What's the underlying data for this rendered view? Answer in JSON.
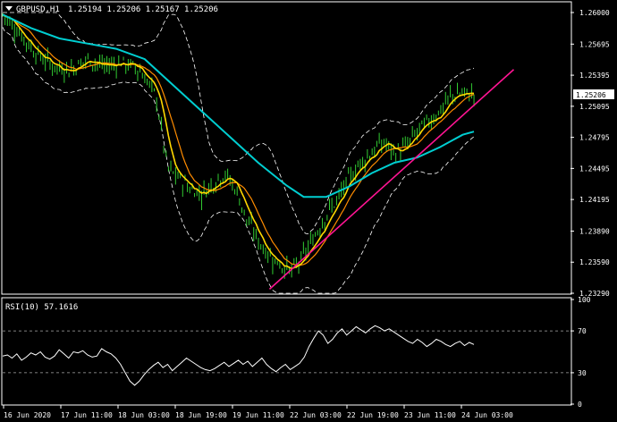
{
  "header": {
    "symbol": "GBPUSD,H1",
    "ohlc": "1.25194 1.25206 1.25167 1.25206"
  },
  "rsi_header": "RSI(10) 57.1616",
  "price_axis": {
    "ticks": [
      "1.26000",
      "1.25695",
      "1.25395",
      "1.25095",
      "1.24795",
      "1.24495",
      "1.24195",
      "1.23890",
      "1.23590",
      "1.23290"
    ],
    "current_price": "1.25206"
  },
  "rsi_axis": {
    "ticks": [
      "100",
      "70",
      "30",
      "0"
    ]
  },
  "time_axis": {
    "labels": [
      "16 Jun 2020",
      "17 Jun 11:00",
      "18 Jun 03:00",
      "18 Jun 19:00",
      "19 Jun 11:00",
      "22 Jun 03:00",
      "22 Jun 19:00",
      "23 Jun 11:00",
      "24 Jun 03:00"
    ]
  },
  "colors": {
    "background": "#000000",
    "candles": "#32CD32",
    "fast_ma": "#FFD700",
    "slow_ma": "#FF8C00",
    "long_ma": "#00CED1",
    "bands": "#FFFFFF",
    "trendline": "#FF1493",
    "rsi": "#FFFFFF",
    "price_tag_bg": "#FFFFFF"
  },
  "chart_data": {
    "type": "line",
    "price_scale": [
      1.2329,
      1.26
    ],
    "close_path": [
      [
        0,
        1.2598
      ],
      [
        0.03,
        1.258
      ],
      [
        0.06,
        1.256
      ],
      [
        0.09,
        1.2548
      ],
      [
        0.12,
        1.2545
      ],
      [
        0.15,
        1.2555
      ],
      [
        0.18,
        1.2548
      ],
      [
        0.21,
        1.2552
      ],
      [
        0.24,
        1.2545
      ],
      [
        0.27,
        1.252
      ],
      [
        0.29,
        1.245
      ],
      [
        0.31,
        1.244
      ],
      [
        0.33,
        1.243
      ],
      [
        0.35,
        1.2425
      ],
      [
        0.37,
        1.2435
      ],
      [
        0.39,
        1.2445
      ],
      [
        0.41,
        1.243
      ],
      [
        0.43,
        1.24
      ],
      [
        0.45,
        1.238
      ],
      [
        0.47,
        1.2365
      ],
      [
        0.49,
        1.2356
      ],
      [
        0.51,
        1.235
      ],
      [
        0.53,
        1.2365
      ],
      [
        0.55,
        1.2385
      ],
      [
        0.57,
        1.2405
      ],
      [
        0.59,
        1.242
      ],
      [
        0.61,
        1.244
      ],
      [
        0.63,
        1.2455
      ],
      [
        0.65,
        1.2465
      ],
      [
        0.67,
        1.2475
      ],
      [
        0.69,
        1.2465
      ],
      [
        0.71,
        1.247
      ],
      [
        0.73,
        1.2485
      ],
      [
        0.75,
        1.2495
      ],
      [
        0.77,
        1.2505
      ],
      [
        0.79,
        1.252
      ],
      [
        0.81,
        1.2522
      ],
      [
        0.83,
        1.2521
      ]
    ],
    "long_ma_path": [
      [
        0,
        1.2598
      ],
      [
        0.05,
        1.2585
      ],
      [
        0.1,
        1.2575
      ],
      [
        0.15,
        1.257
      ],
      [
        0.2,
        1.2565
      ],
      [
        0.25,
        1.2555
      ],
      [
        0.3,
        1.253
      ],
      [
        0.35,
        1.2505
      ],
      [
        0.4,
        1.248
      ],
      [
        0.45,
        1.2455
      ],
      [
        0.5,
        1.2433
      ],
      [
        0.53,
        1.2422
      ],
      [
        0.57,
        1.2422
      ],
      [
        0.61,
        1.2432
      ],
      [
        0.65,
        1.2445
      ],
      [
        0.69,
        1.2455
      ],
      [
        0.73,
        1.246
      ],
      [
        0.77,
        1.247
      ],
      [
        0.81,
        1.2482
      ],
      [
        0.83,
        1.2485
      ]
    ],
    "trendline": [
      [
        0.47,
        1.2333
      ],
      [
        0.9,
        1.2545
      ]
    ],
    "rsi_scale": [
      0,
      100
    ],
    "rsi_levels": [
      30,
      70
    ],
    "rsi_values": [
      46,
      47,
      44,
      48,
      42,
      45,
      49,
      47,
      50,
      45,
      43,
      46,
      52,
      48,
      44,
      50,
      49,
      51,
      47,
      45,
      46,
      53,
      50,
      48,
      44,
      38,
      30,
      22,
      18,
      22,
      28,
      33,
      37,
      40,
      35,
      38,
      32,
      36,
      40,
      44,
      41,
      38,
      35,
      33,
      32,
      34,
      37,
      40,
      36,
      39,
      42,
      38,
      41,
      36,
      40,
      44,
      38,
      34,
      31,
      35,
      38,
      33,
      36,
      39,
      45,
      55,
      63,
      70,
      66,
      58,
      62,
      68,
      72,
      66,
      70,
      74,
      71,
      68,
      72,
      75,
      73,
      70,
      72,
      69,
      66,
      63,
      60,
      58,
      62,
      59,
      55,
      58,
      62,
      60,
      57,
      55,
      58,
      60,
      56,
      59,
      57
    ]
  }
}
